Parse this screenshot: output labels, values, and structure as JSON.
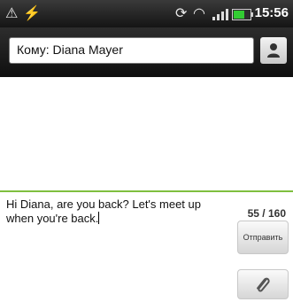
{
  "status_bar": {
    "time": "15:56",
    "icons": [
      "android-debug-icon",
      "usb-icon",
      "sync-icon",
      "wifi-icon",
      "signal-icon",
      "battery-icon"
    ],
    "battery_level": 0.62
  },
  "compose": {
    "to_field_value": "Кому: Diana Mayer",
    "message_text": "Hi Diana, are you back? Let's meet up when you're back.",
    "char_counter": "55 / 160",
    "send_label": "Отправить",
    "attach_icon": "paperclip-icon",
    "contact_icon": "person-icon"
  },
  "colors": {
    "accent_border": "#7fbf3f",
    "battery_fill": "#33cc33"
  }
}
